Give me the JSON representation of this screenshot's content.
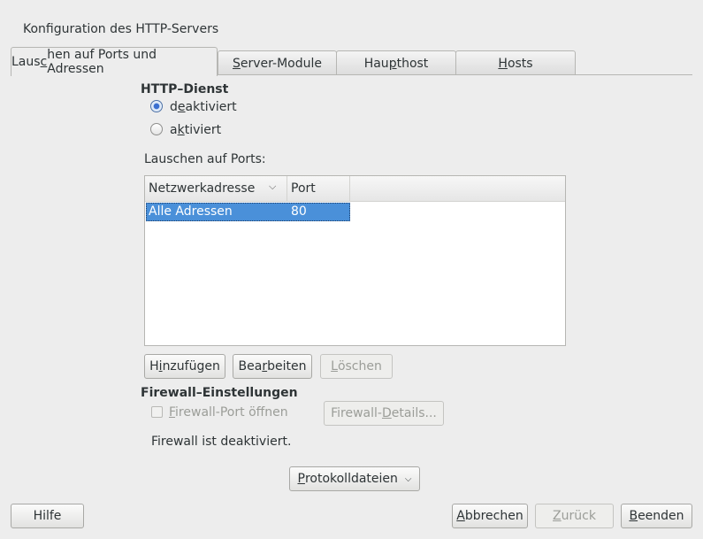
{
  "window": {
    "title": "Konfiguration des HTTP-Servers"
  },
  "tabs": [
    {
      "label_pre": "Laus",
      "label_u": "c",
      "label_post": "hen auf Ports und Adressen",
      "active": true
    },
    {
      "label_pre": "",
      "label_u": "S",
      "label_post": "erver-Module",
      "active": false
    },
    {
      "label_pre": "Hau",
      "label_u": "p",
      "label_post": "thost",
      "active": false
    },
    {
      "label_pre": "",
      "label_u": "H",
      "label_post": "osts",
      "active": false
    }
  ],
  "http_service": {
    "heading": "HTTP–Dienst",
    "options": [
      {
        "pre": "d",
        "u": "e",
        "post": "aktiviert",
        "checked": true
      },
      {
        "pre": "a",
        "u": "k",
        "post": "tiviert",
        "checked": false
      }
    ]
  },
  "ports": {
    "label": "Lauschen auf Ports:",
    "columns": [
      "Netzwerkadresse",
      "Port"
    ],
    "rows": [
      {
        "address": "Alle Adressen",
        "port": "80"
      }
    ]
  },
  "port_buttons": {
    "add": {
      "pre": "H",
      "u": "i",
      "post": "nzufügen"
    },
    "edit": {
      "pre": "Bea",
      "u": "r",
      "post": "beiten"
    },
    "delete": {
      "pre": "",
      "u": "L",
      "post": "öschen"
    }
  },
  "firewall": {
    "heading": "Firewall–Einstellungen",
    "open_port": {
      "pre": "",
      "u": "F",
      "post": "irewall-Port öffnen"
    },
    "details": {
      "pre": "Firewall-",
      "u": "D",
      "post": "etails..."
    },
    "status": "Firewall ist deaktiviert."
  },
  "logs_menu": {
    "pre": "",
    "u": "P",
    "post": "rotokolldateien"
  },
  "footer": {
    "help": "Hilfe",
    "cancel": {
      "pre": "",
      "u": "A",
      "post": "bbrechen"
    },
    "back": {
      "pre": "",
      "u": "Z",
      "post": "urück"
    },
    "finish": {
      "pre": "",
      "u": "B",
      "post": "eenden"
    }
  }
}
